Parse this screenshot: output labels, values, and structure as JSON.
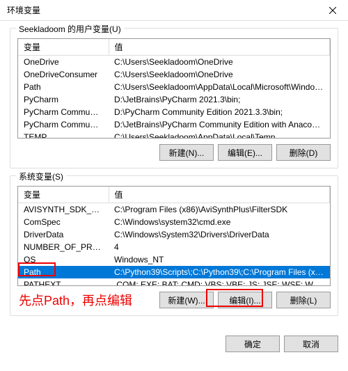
{
  "window": {
    "title": "环境变量"
  },
  "user_section": {
    "label": "Seekladoom 的用户变量(U)",
    "col_var": "变量",
    "col_val": "值",
    "rows": [
      {
        "var": "OneDrive",
        "val": "C:\\Users\\Seekladoom\\OneDrive"
      },
      {
        "var": "OneDriveConsumer",
        "val": "C:\\Users\\Seekladoom\\OneDrive"
      },
      {
        "var": "Path",
        "val": "C:\\Users\\Seekladoom\\AppData\\Local\\Microsoft\\WindowsAp..."
      },
      {
        "var": "PyCharm",
        "val": "D:\\JetBrains\\PyCharm 2021.3\\bin;"
      },
      {
        "var": "PyCharm Community Editi...",
        "val": "D:\\PyCharm Community Edition 2021.3.3\\bin;"
      },
      {
        "var": "PyCharm Community Editi...",
        "val": "D:\\JetBrains\\PyCharm Community Edition with Anaconda plug..."
      },
      {
        "var": "TEMP",
        "val": "C:\\Users\\Seekladoom\\AppData\\Local\\Temp"
      }
    ],
    "btn_new": "新建(N)...",
    "btn_edit": "编辑(E)...",
    "btn_delete": "删除(D)"
  },
  "system_section": {
    "label": "系统变量(S)",
    "col_var": "变量",
    "col_val": "值",
    "rows": [
      {
        "var": "AVISYNTH_SDK_PATH",
        "val": "C:\\Program Files (x86)\\AviSynthPlus\\FilterSDK"
      },
      {
        "var": "ComSpec",
        "val": "C:\\Windows\\system32\\cmd.exe"
      },
      {
        "var": "DriverData",
        "val": "C:\\Windows\\System32\\Drivers\\DriverData"
      },
      {
        "var": "NUMBER_OF_PROCESSORS",
        "val": "4"
      },
      {
        "var": "OS",
        "val": "Windows_NT"
      },
      {
        "var": "Path",
        "val": "C:\\Python39\\Scripts\\;C:\\Python39\\;C:\\Program Files (x86)\\Co..."
      },
      {
        "var": "PATHEXT",
        "val": ".COM;.EXE;.BAT;.CMD;.VBS;.VBE;.JS;.JSE;.WSF;.WSH;.MSC;.PY;.P..."
      }
    ],
    "btn_new": "新建(W)...",
    "btn_edit": "编辑(I)...",
    "btn_delete": "删除(L)"
  },
  "footer": {
    "ok": "确定",
    "cancel": "取消"
  },
  "annotation": "先点Path，再点编辑"
}
